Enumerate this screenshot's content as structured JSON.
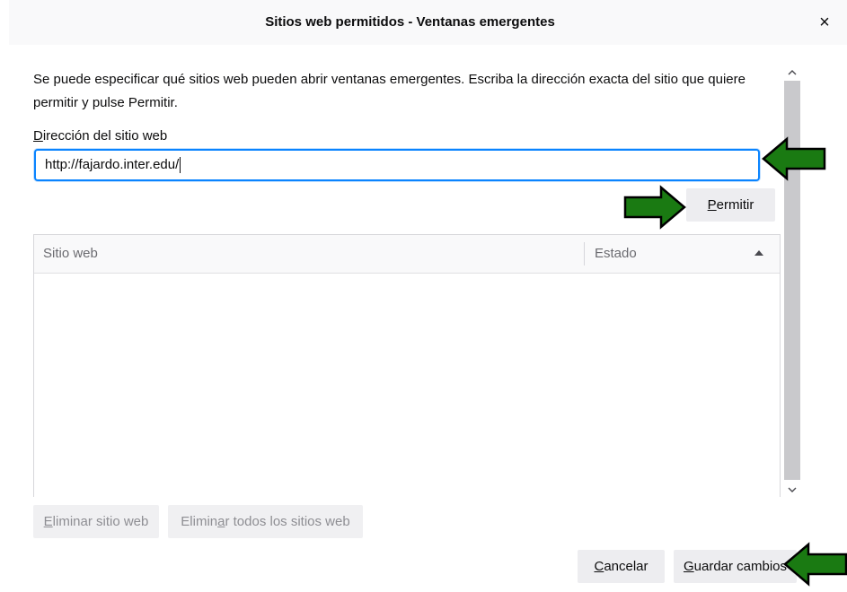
{
  "dialog": {
    "title": "Sitios web permitidos - Ventanas emergentes",
    "close_glyph": "×",
    "description": "Se puede especificar qué sitios web pueden abrir ventanas emergentes. Escriba la dirección exacta del sitio que quiere permitir y pulse Permitir."
  },
  "address_field": {
    "label_accesskey": "D",
    "label_rest": "irección del sitio web",
    "value": "http://fajardo.inter.edu/"
  },
  "permit_button": {
    "accesskey": "P",
    "rest": "ermitir"
  },
  "table": {
    "col_site": "Sitio web",
    "col_status": "Estado"
  },
  "remove_button": {
    "accesskey": "E",
    "rest": "liminar sitio web"
  },
  "remove_all_button": {
    "before": "Elimin",
    "accesskey": "a",
    "after": "r todos los sitios web"
  },
  "cancel_button": {
    "accesskey": "C",
    "rest": "ancelar"
  },
  "save_button": {
    "accesskey": "G",
    "rest": "uardar cambios"
  },
  "colors": {
    "accent": "#0a84ff",
    "arrow_fill": "#1a7a12",
    "arrow_stroke": "#000000"
  }
}
